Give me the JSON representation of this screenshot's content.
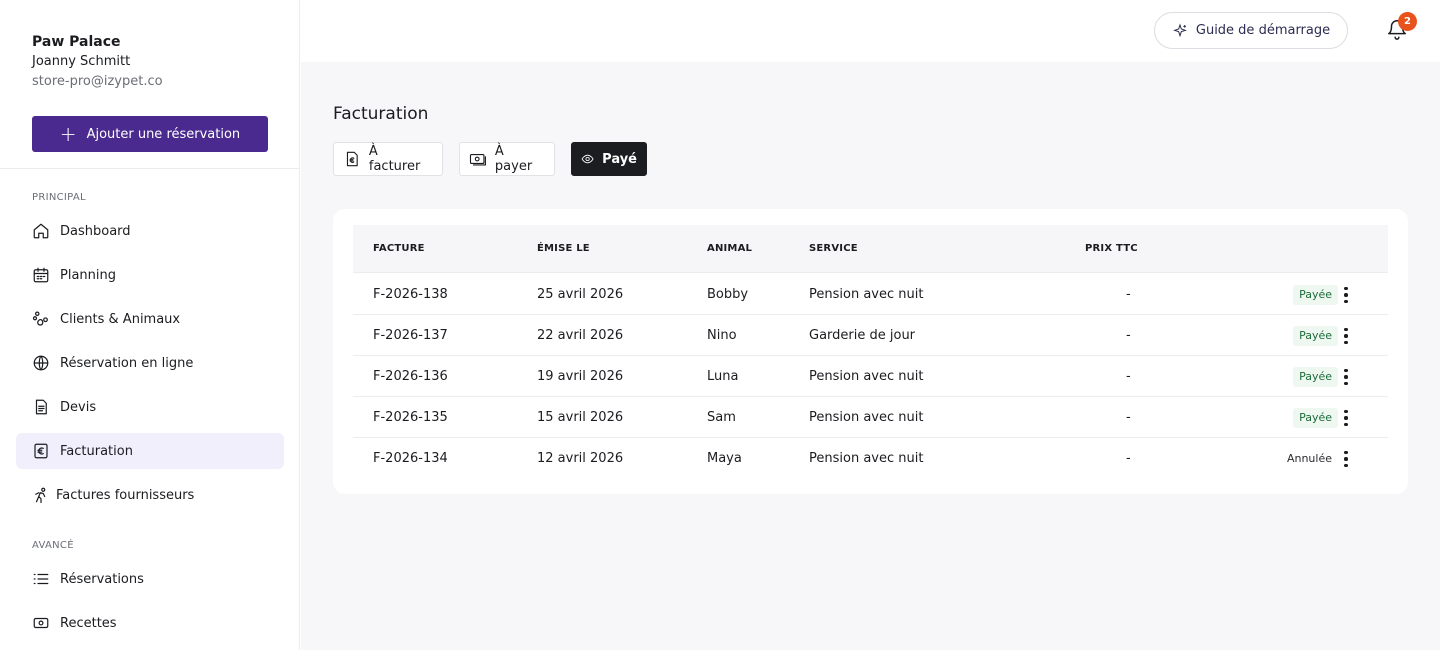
{
  "brand": {
    "name": "Paw Palace",
    "user": "Joanny Schmitt",
    "email": "store-pro@izypet.co"
  },
  "add_button": {
    "label": "Ajouter une réservation"
  },
  "sidebar": {
    "section_principal": "PRINCIPAL",
    "section_avance": "AVANCÉ",
    "items": [
      {
        "label": "Dashboard",
        "icon": "home-icon"
      },
      {
        "label": "Planning",
        "icon": "calendar-icon"
      },
      {
        "label": "Clients & Animaux",
        "icon": "paw-icon"
      },
      {
        "label": "Réservation en ligne",
        "icon": "globe-icon"
      },
      {
        "label": "Devis",
        "icon": "document-icon"
      },
      {
        "label": "Facturation",
        "icon": "euro-icon",
        "active": true
      },
      {
        "label": "Factures fournisseurs",
        "icon": "supplier-icon"
      },
      {
        "label": "Réservations",
        "icon": "list-icon"
      },
      {
        "label": "Recettes",
        "icon": "cash-icon"
      }
    ]
  },
  "topbar": {
    "guide_label": "Guide de démarrage",
    "notification_count": "2"
  },
  "page": {
    "title": "Facturation",
    "tabs": [
      {
        "label": "À facturer",
        "icon": "invoice-euro-icon"
      },
      {
        "label": "À payer",
        "icon": "money-icon"
      },
      {
        "label": "Payé",
        "icon": "eye-icon",
        "active": true
      }
    ]
  },
  "table": {
    "headers": [
      "FACTURE",
      "ÉMISE LE",
      "ANIMAL",
      "SERVICE",
      "PRIX TTC"
    ],
    "rows": [
      {
        "facture": "F-2026-138",
        "date": "25 avril 2026",
        "animal": "Bobby",
        "service": "Pension avec nuit",
        "prix": "-",
        "status": "Payée"
      },
      {
        "facture": "F-2026-137",
        "date": "22 avril 2026",
        "animal": "Nino",
        "service": "Garderie de jour",
        "prix": "-",
        "status": "Payée"
      },
      {
        "facture": "F-2026-136",
        "date": "19 avril 2026",
        "animal": "Luna",
        "service": "Pension avec nuit",
        "prix": "-",
        "status": "Payée"
      },
      {
        "facture": "F-2026-135",
        "date": "15 avril 2026",
        "animal": "Sam",
        "service": "Pension avec nuit",
        "prix": "-",
        "status": "Payée"
      },
      {
        "facture": "F-2026-134",
        "date": "12 avril 2026",
        "animal": "Maya",
        "service": "Pension avec nuit",
        "prix": "-",
        "status": "Annulée"
      }
    ]
  },
  "colors": {
    "primary": "#4a2a8f",
    "active_nav_bg": "#f1effb",
    "badge": "#e8521d",
    "paid_bg": "#eef8f1",
    "paid_text": "#1c6b3a",
    "active_tab_bg": "#1c1d20"
  }
}
